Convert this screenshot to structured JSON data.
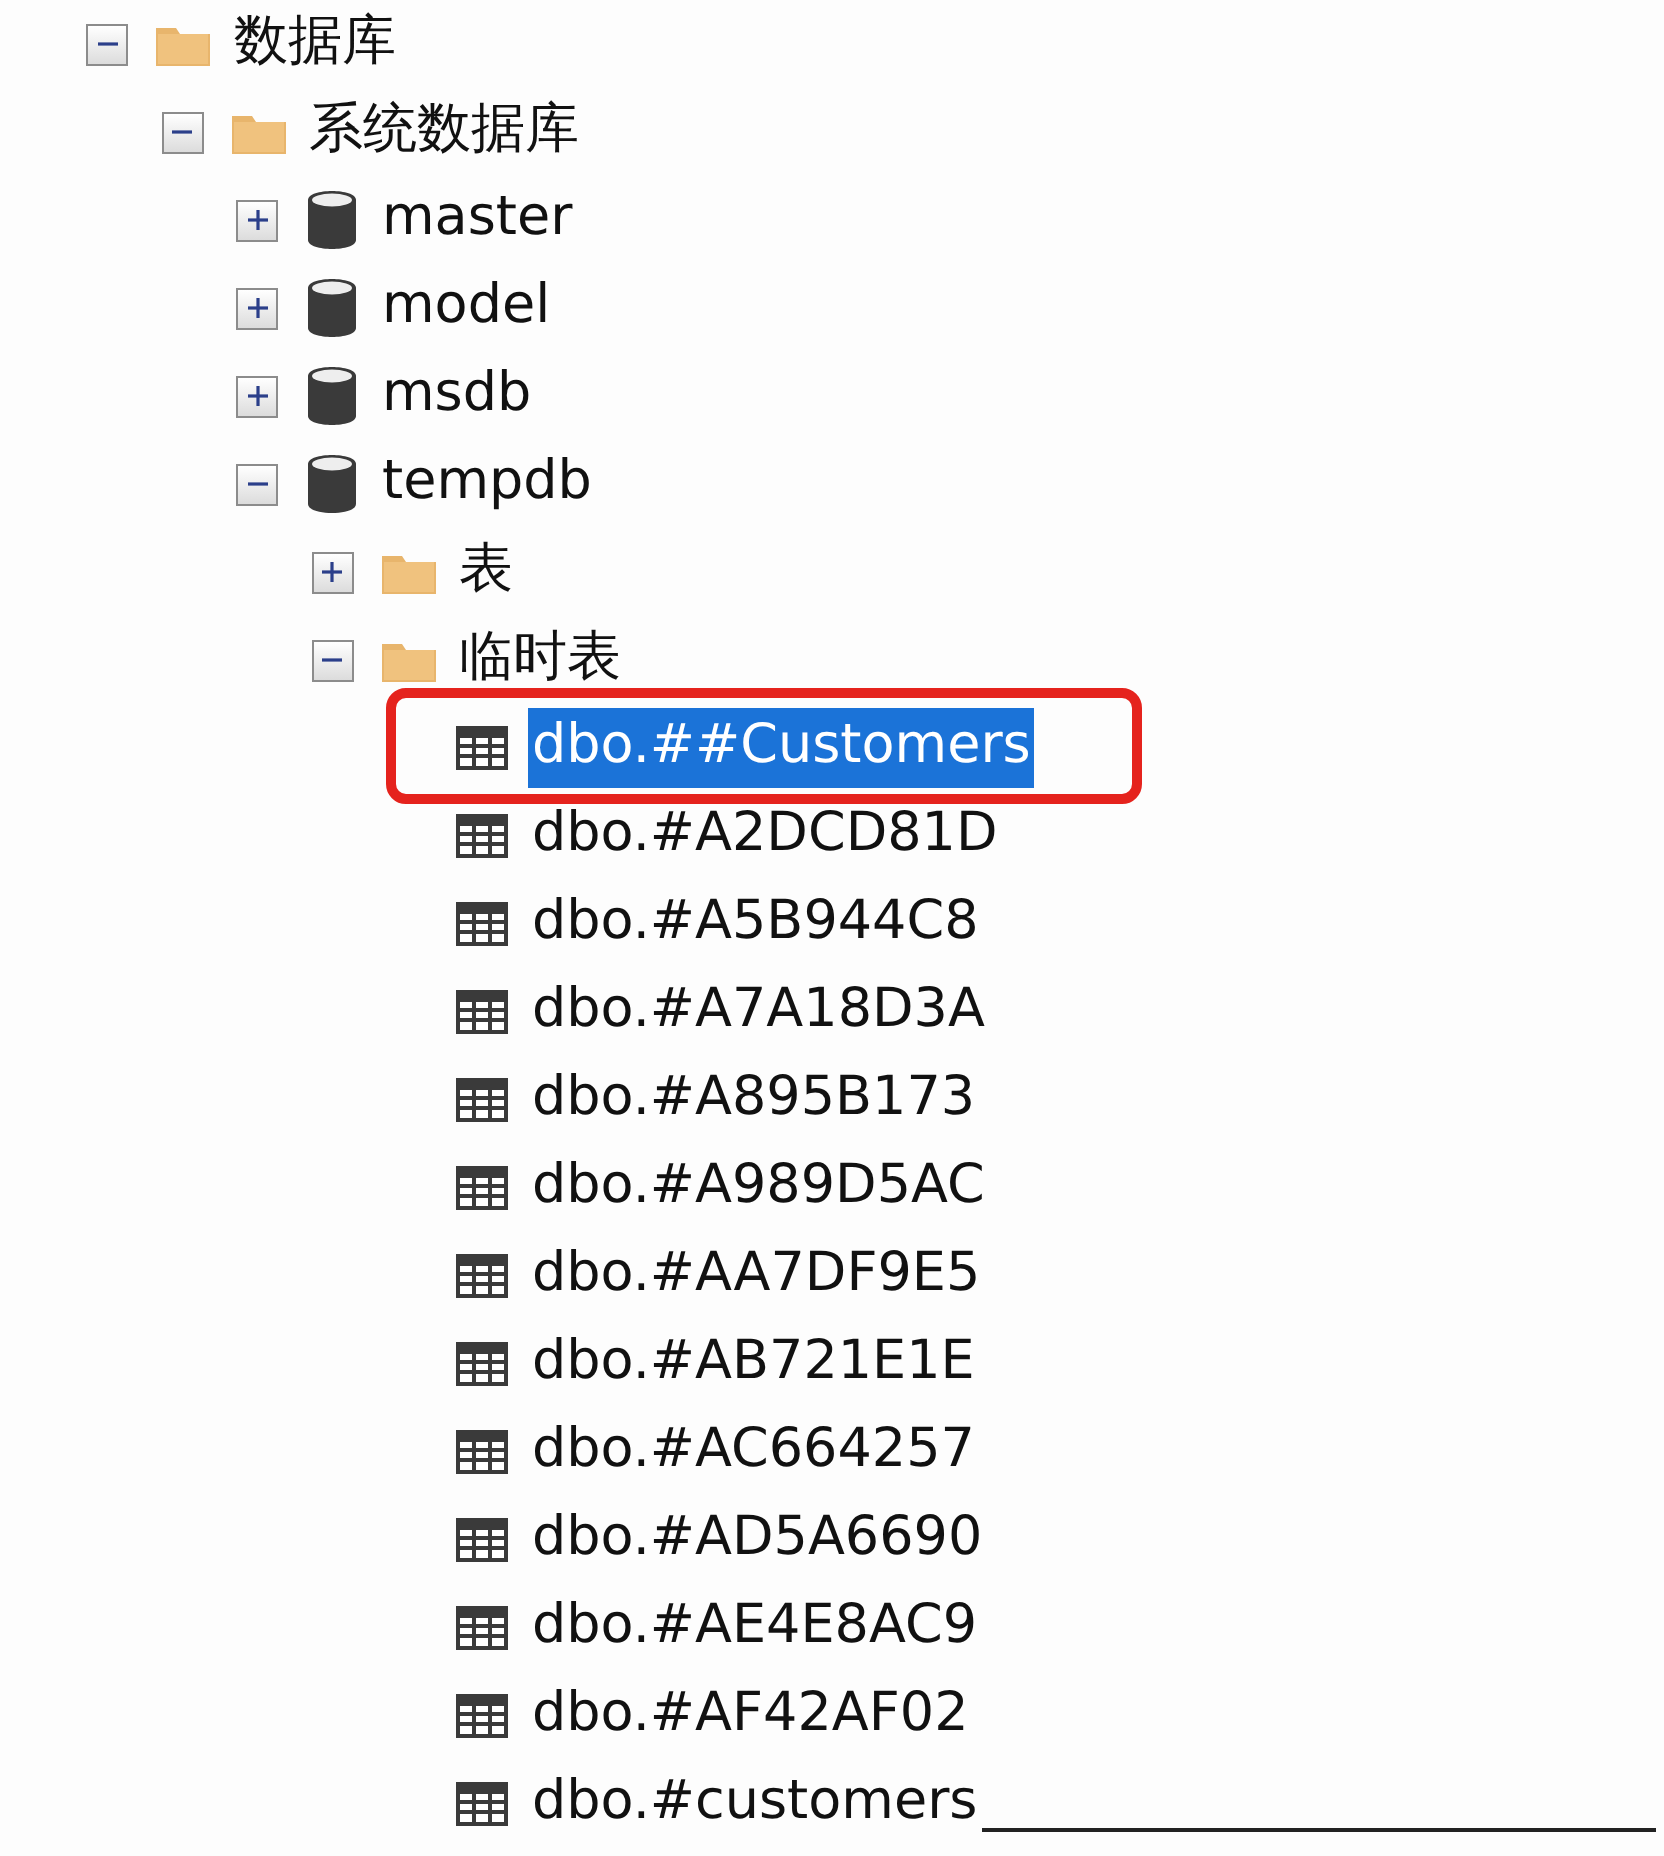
{
  "tree": [
    {
      "label": "数据库",
      "kind": "folder",
      "expanded": true,
      "selected": false,
      "children": [
        {
          "label": "系统数据库",
          "kind": "folder",
          "expanded": true,
          "selected": false,
          "children": [
            {
              "label": "master",
              "kind": "database",
              "expanded": false,
              "selected": false
            },
            {
              "label": "model",
              "kind": "database",
              "expanded": false,
              "selected": false
            },
            {
              "label": "msdb",
              "kind": "database",
              "expanded": false,
              "selected": false
            },
            {
              "label": "tempdb",
              "kind": "database",
              "expanded": true,
              "selected": false,
              "children": [
                {
                  "label": "表",
                  "kind": "folder",
                  "expanded": false,
                  "selected": false
                },
                {
                  "label": "临时表",
                  "kind": "folder",
                  "expanded": true,
                  "selected": false,
                  "children": [
                    {
                      "label": "dbo.##Customers",
                      "kind": "table",
                      "selected": true,
                      "circled": true
                    },
                    {
                      "label": "dbo.#A2DCD81D",
                      "kind": "table",
                      "selected": false
                    },
                    {
                      "label": "dbo.#A5B944C8",
                      "kind": "table",
                      "selected": false
                    },
                    {
                      "label": "dbo.#A7A18D3A",
                      "kind": "table",
                      "selected": false
                    },
                    {
                      "label": "dbo.#A895B173",
                      "kind": "table",
                      "selected": false
                    },
                    {
                      "label": "dbo.#A989D5AC",
                      "kind": "table",
                      "selected": false
                    },
                    {
                      "label": "dbo.#AA7DF9E5",
                      "kind": "table",
                      "selected": false
                    },
                    {
                      "label": "dbo.#AB721E1E",
                      "kind": "table",
                      "selected": false
                    },
                    {
                      "label": "dbo.#AC664257",
                      "kind": "table",
                      "selected": false
                    },
                    {
                      "label": "dbo.#AD5A6690",
                      "kind": "table",
                      "selected": false
                    },
                    {
                      "label": "dbo.#AE4E8AC9",
                      "kind": "table",
                      "selected": false
                    },
                    {
                      "label": "dbo.#AF42AF02",
                      "kind": "table",
                      "selected": false
                    },
                    {
                      "label": "dbo.#customers",
                      "kind": "table",
                      "selected": false
                    }
                  ]
                }
              ]
            }
          ]
        }
      ]
    }
  ]
}
